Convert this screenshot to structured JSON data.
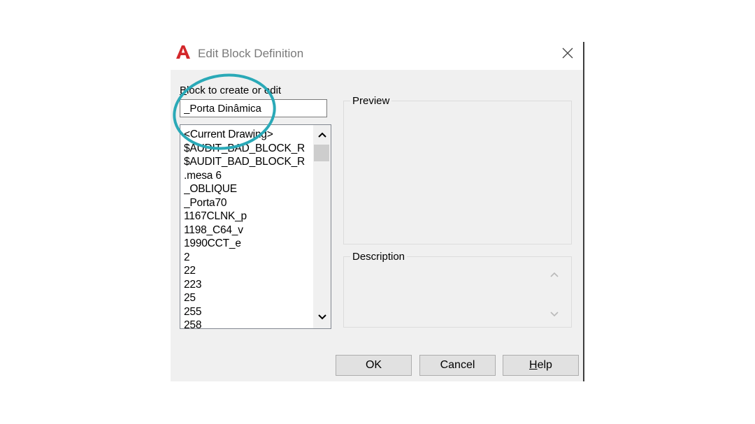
{
  "dialog": {
    "title": "Edit Block Definition",
    "icons": {
      "app": "autocad-a-icon",
      "close": "close-icon"
    }
  },
  "block_field": {
    "label_accel": "B",
    "label_rest": "lock to create or edit",
    "value": "_Porta Dinâmica"
  },
  "block_list": {
    "items": [
      "<Current Drawing>",
      "$AUDIT_BAD_BLOCK_R",
      "$AUDIT_BAD_BLOCK_R",
      ".mesa 6",
      "_OBLIQUE",
      "_Porta70",
      "1167CLNK_p",
      "1198_C64_v",
      "1990CCT_e",
      "2",
      "22",
      "223",
      "25",
      "255",
      "258"
    ],
    "scroll_icons": {
      "up": "chevron-up-icon",
      "down": "chevron-down-icon"
    }
  },
  "preview": {
    "label": "Preview"
  },
  "description": {
    "label": "Description"
  },
  "buttons": {
    "ok": "OK",
    "cancel": "Cancel",
    "help_accel": "H",
    "help_rest": "elp"
  },
  "colors": {
    "highlight_circle": "#2aa9b7",
    "app_icon": "#d3282b",
    "dialog_bg": "#f0f0f0"
  }
}
